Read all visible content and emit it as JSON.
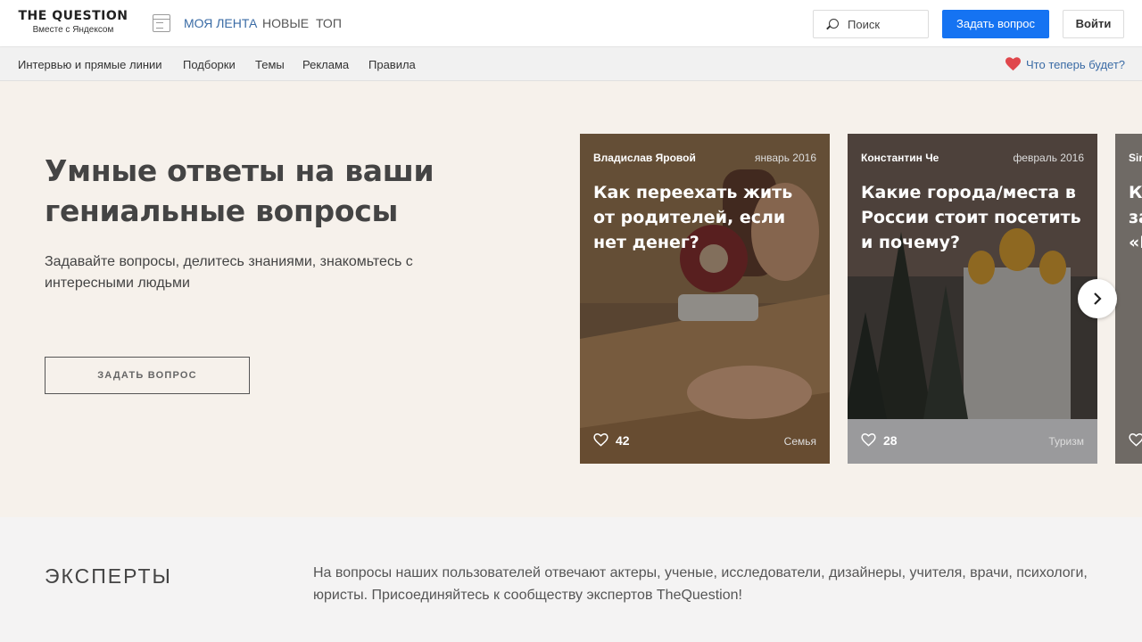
{
  "header": {
    "logo_title": "THE QUESTION",
    "logo_subtitle": "Вместе с Яндексом",
    "tabs": [
      {
        "label": "МОЯ ЛЕНТА",
        "active": true
      },
      {
        "label": "НОВЫЕ",
        "active": false
      },
      {
        "label": "ТОП",
        "active": false
      }
    ],
    "search_placeholder": "Поиск",
    "ask_button": "Задать вопрос",
    "login_button": "Войти"
  },
  "subnav": {
    "items": [
      "Интервью и прямые линии",
      "Подборки",
      "Темы",
      "Реклама",
      "Правила"
    ],
    "future_link": "Что теперь будет?"
  },
  "hero": {
    "title": "Умные ответы на ваши гениальные вопросы",
    "subtitle": "Задавайте вопросы, делитесь знаниями, знакомьтесь с интересными людьми",
    "ask_button": "ЗАДАТЬ ВОПРОС"
  },
  "cards": [
    {
      "author": "Владислав Яровой",
      "date": "январь 2016",
      "title": "Как переехать жить от родителей, если нет денег?",
      "likes": "42",
      "topic": "Семья"
    },
    {
      "author": "Константин Че",
      "date": "февраль 2016",
      "title": "Какие города/места в России стоит посетить и почему?",
      "likes": "28",
      "topic": "Туризм"
    },
    {
      "author": "Sir",
      "date": "",
      "title": "К за «I",
      "likes": "",
      "topic": ""
    }
  ],
  "experts": {
    "title": "ЭКСПЕРТЫ",
    "text": "На вопросы наших пользователей отвечают актеры, ученые, исследователи, дизайнеры, учителя, врачи, психологи, юристы. Присоединяйтесь к сообществу экспертов TheQuestion!"
  },
  "colors": {
    "accent_blue": "#1573f2",
    "link_blue": "#3a6ba5",
    "hero_bg": "#f6f1eb",
    "heart_red": "#e0474c"
  },
  "icons": [
    "feed-icon",
    "search-icon",
    "heart-icon",
    "like-icon",
    "chevron-right-icon"
  ]
}
